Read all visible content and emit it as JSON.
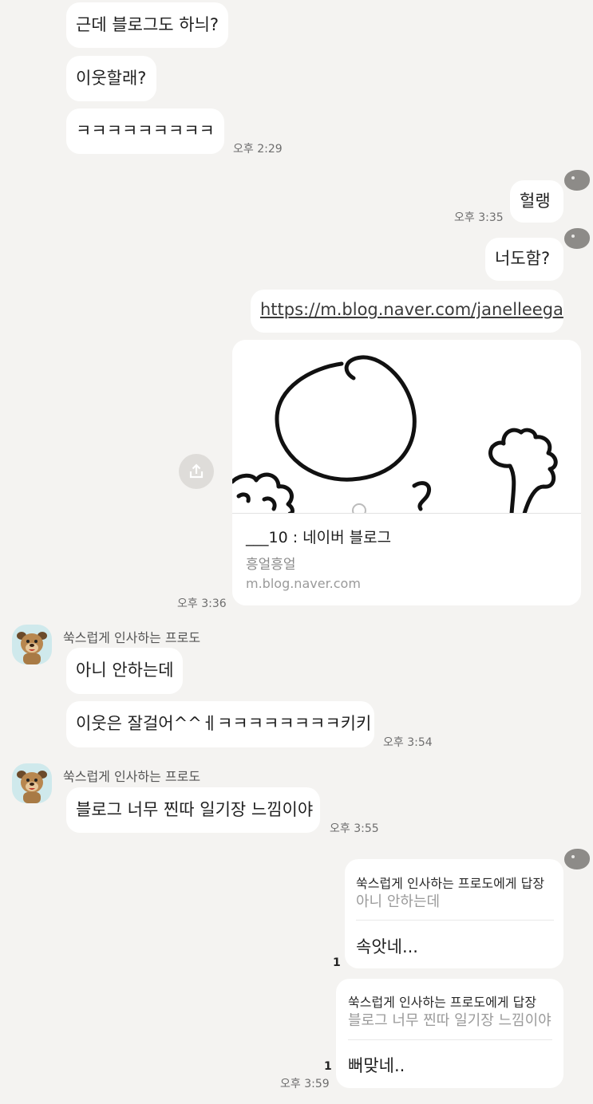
{
  "messages_top": [
    {
      "text": "근데 블로그도 하늬?"
    },
    {
      "text": "이웃할래?"
    },
    {
      "text": "ㅋㅋㅋㅋㅋㅋㅋㅋㅋ",
      "time": "오후 2:29"
    }
  ],
  "my_messages": [
    {
      "text": "헐랭",
      "time": "오후 3:35"
    },
    {
      "text": "너도함?"
    },
    {
      "text": "https://m.blog.naver.com/janelleega"
    }
  ],
  "link_card": {
    "title": "___10 : 네이버 블로그",
    "subtitle": "흥얼흥얼",
    "domain": "m.blog.naver.com",
    "time": "오후 3:36"
  },
  "friend": {
    "name": "쑥스럽게 인사하는 프로도"
  },
  "friend_group1": [
    {
      "text": "아니 안하는데"
    },
    {
      "text": "이웃은 잘걸어^^ㅔㅋㅋㅋㅋㅋㅋㅋㅋ키키",
      "time": "오후 3:54"
    }
  ],
  "friend_group2": [
    {
      "text": "블로그 너무 찐따 일기장 느낌이야",
      "time": "오후 3:55"
    }
  ],
  "replies": [
    {
      "header": "쑥스럽게 인사하는 프로도에게 답장",
      "quote": "아니 안하는데",
      "text": "속앗네...",
      "unread": "1"
    },
    {
      "header": "쑥스럽게 인사하는 프로도에게 답장",
      "quote": "블로그 너무 찐따 일기장 느낌이야",
      "text": "뻐맞네..",
      "unread": "1",
      "time": "오후 3:59"
    }
  ]
}
